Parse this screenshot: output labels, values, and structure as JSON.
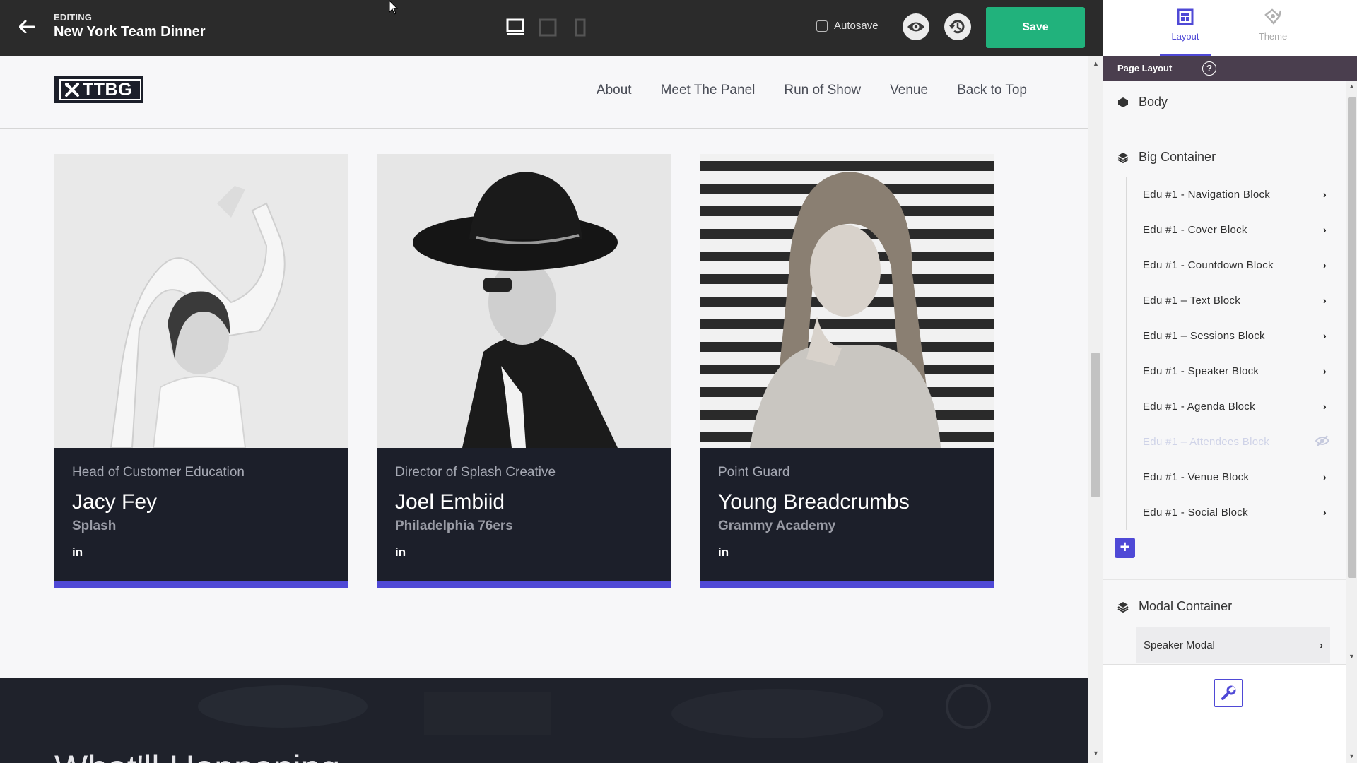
{
  "topbar": {
    "editing_label": "EDITING",
    "doc_title": "New York Team Dinner",
    "autosave_label": "Autosave",
    "save_label": "Save"
  },
  "site": {
    "logo_text": "TTBG",
    "nav": [
      "About",
      "Meet The Panel",
      "Run of Show",
      "Venue",
      "Back to Top"
    ]
  },
  "speakers": [
    {
      "role": "Head of Customer Education",
      "name": "Jacy Fey",
      "org": "Splash",
      "social": "in"
    },
    {
      "role": "Director of Splash Creative",
      "name": "Joel Embiid",
      "org": "Philadelphia 76ers",
      "social": "in"
    },
    {
      "role": "Point Guard",
      "name": "Young Breadcrumbs",
      "org": "Grammy Academy",
      "social": "in"
    }
  ],
  "section_heading_partial": "What'll Happening",
  "panel": {
    "tabs": {
      "layout": "Layout",
      "theme": "Theme"
    },
    "page_layout_label": "Page Layout",
    "help_glyph": "?",
    "body_label": "Body",
    "big_container_label": "Big Container",
    "blocks": [
      "Edu #1 - Navigation Block",
      "Edu #1 - Cover Block",
      "Edu #1 - Countdown Block",
      "Edu #1 – Text Block",
      "Edu #1 – Sessions Block",
      "Edu #1 - Speaker Block",
      "Edu #1 - Agenda Block",
      "Edu #1 – Attendees Block",
      "Edu #1 - Venue Block",
      "Edu #1 - Social Block"
    ],
    "hidden_block_index": 7,
    "add_glyph": "+",
    "modal_container_label": "Modal Container",
    "modal_items": [
      "Speaker Modal"
    ]
  },
  "colors": {
    "accent": "#4f49d6",
    "save_green": "#21b27c",
    "topbar_bg": "#2b2b2b",
    "card_bg": "#1c1f2a"
  }
}
